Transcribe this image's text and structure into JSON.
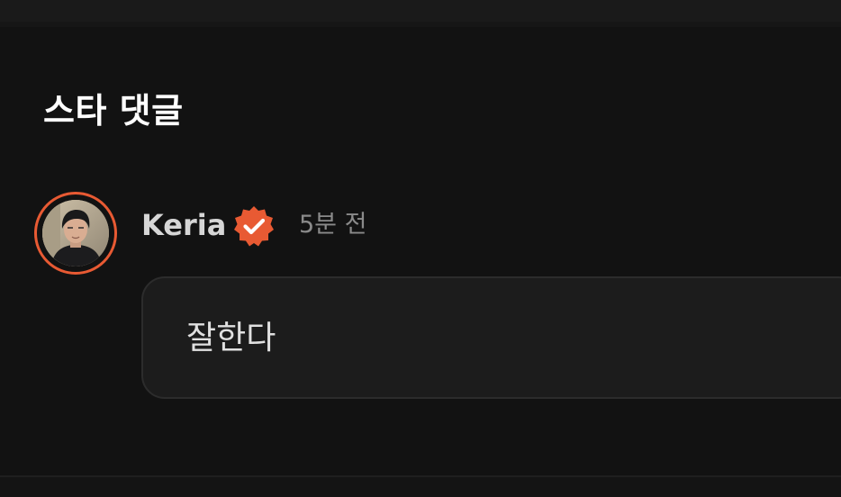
{
  "section": {
    "title": "스타 댓글"
  },
  "comment": {
    "username": "Keria",
    "verified": true,
    "timestamp": "5분 전",
    "text": "잘한다"
  },
  "colors": {
    "background": "#121212",
    "accent": "#e85a33",
    "bubble": "#1c1c1c",
    "username": "#d6d6d6",
    "timestamp": "#8a8a8a"
  },
  "icons": {
    "badge": "verified-check-icon",
    "avatar": "user-avatar"
  }
}
